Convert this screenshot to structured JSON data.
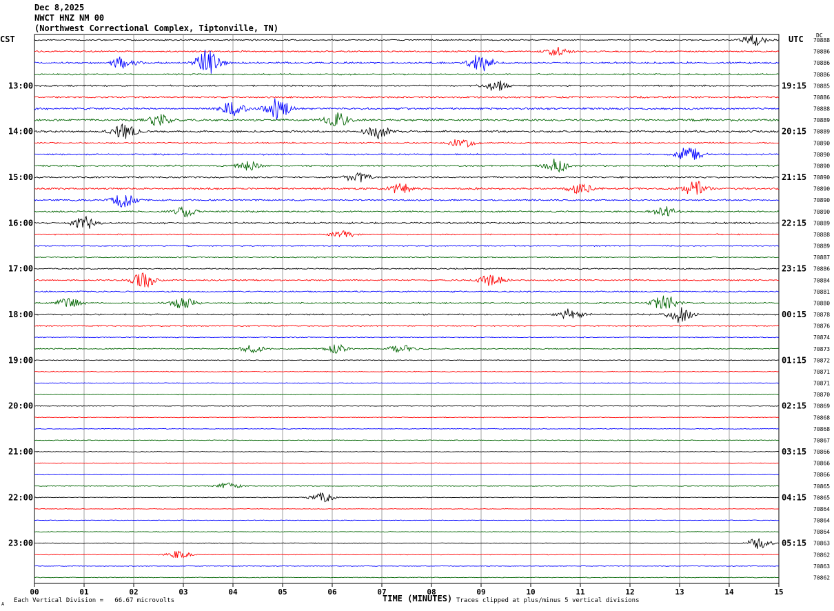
{
  "header": {
    "date": "Dec 8,2025",
    "station": "NWCT HNZ NM 00",
    "location": "(Northwest Correctional Complex, Tiptonville, TN)"
  },
  "left_tz": "CST",
  "right_tz": "UTC",
  "dc_label": "DC",
  "footer": {
    "scale": "Each Vertical Division =   66.67 microvolts",
    "clip": "Traces clipped at plus/minus 5 vertical divisions",
    "mark": "A"
  },
  "chart_data": {
    "type": "line",
    "title": "",
    "xlabel": "TIME (MINUTES)",
    "ylabel": "",
    "xlim": [
      0,
      15
    ],
    "x_ticks": [
      "00",
      "01",
      "02",
      "03",
      "04",
      "05",
      "06",
      "07",
      "08",
      "09",
      "10",
      "11",
      "12",
      "13",
      "14",
      "15"
    ],
    "grid": true,
    "trace_colors": [
      "#000000",
      "#ff0000",
      "#0000ff",
      "#006400"
    ],
    "left_hour_labels": [
      "13:00",
      "14:00",
      "15:00",
      "16:00",
      "17:00",
      "18:00",
      "19:00",
      "20:00",
      "21:00",
      "22:00",
      "23:00"
    ],
    "right_hour_labels": [
      "19:15",
      "20:15",
      "21:15",
      "22:15",
      "23:15",
      "00:15",
      "01:15",
      "02:15",
      "03:15",
      "04:15",
      "05:15"
    ],
    "dc_values": [
      "70888",
      "70886",
      "70886",
      "70886",
      "70885",
      "70886",
      "70888",
      "70889",
      "70889",
      "70890",
      "70890",
      "70890",
      "70890",
      "70890",
      "70890",
      "70890",
      "70889",
      "70888",
      "70889",
      "70887",
      "70886",
      "70884",
      "70881",
      "70880",
      "70878",
      "70876",
      "70874",
      "70873",
      "70872",
      "70871",
      "70871",
      "70870",
      "70869",
      "70868",
      "70868",
      "70867",
      "70866",
      "70866",
      "70866",
      "70865",
      "70865",
      "70864",
      "70864",
      "70864",
      "70863",
      "70862",
      "70863",
      "70862"
    ],
    "trace_activity": [
      0.5,
      0.55,
      0.7,
      0.55,
      0.55,
      0.65,
      0.7,
      0.75,
      0.75,
      0.55,
      0.55,
      0.6,
      0.6,
      0.7,
      0.6,
      0.6,
      0.65,
      0.45,
      0.45,
      0.4,
      0.45,
      0.55,
      0.5,
      0.55,
      0.55,
      0.45,
      0.35,
      0.4,
      0.3,
      0.3,
      0.3,
      0.28,
      0.28,
      0.28,
      0.28,
      0.3,
      0.28,
      0.25,
      0.25,
      0.28,
      0.28,
      0.25,
      0.25,
      0.25,
      0.28,
      0.28,
      0.25,
      0.28
    ],
    "events": [
      {
        "trace": 0,
        "minute": 14.5,
        "amp": 8
      },
      {
        "trace": 1,
        "minute": 10.5,
        "amp": 7
      },
      {
        "trace": 2,
        "minute": 3.5,
        "amp": 22
      },
      {
        "trace": 2,
        "minute": 9.0,
        "amp": 14
      },
      {
        "trace": 2,
        "minute": 1.8,
        "amp": 10
      },
      {
        "trace": 4,
        "minute": 9.3,
        "amp": 8
      },
      {
        "trace": 6,
        "minute": 4.9,
        "amp": 16
      },
      {
        "trace": 6,
        "minute": 4.0,
        "amp": 10
      },
      {
        "trace": 7,
        "minute": 6.1,
        "amp": 10
      },
      {
        "trace": 7,
        "minute": 2.5,
        "amp": 9
      },
      {
        "trace": 8,
        "minute": 1.8,
        "amp": 10
      },
      {
        "trace": 8,
        "minute": 6.9,
        "amp": 11
      },
      {
        "trace": 9,
        "minute": 8.6,
        "amp": 7
      },
      {
        "trace": 10,
        "minute": 13.2,
        "amp": 12
      },
      {
        "trace": 11,
        "minute": 10.5,
        "amp": 10
      },
      {
        "trace": 11,
        "minute": 4.3,
        "amp": 6
      },
      {
        "trace": 12,
        "minute": 6.5,
        "amp": 7
      },
      {
        "trace": 13,
        "minute": 7.4,
        "amp": 8
      },
      {
        "trace": 13,
        "minute": 13.3,
        "amp": 11
      },
      {
        "trace": 13,
        "minute": 11.0,
        "amp": 7
      },
      {
        "trace": 14,
        "minute": 1.8,
        "amp": 10
      },
      {
        "trace": 15,
        "minute": 3.0,
        "amp": 7
      },
      {
        "trace": 15,
        "minute": 12.7,
        "amp": 7
      },
      {
        "trace": 16,
        "minute": 1.0,
        "amp": 9
      },
      {
        "trace": 17,
        "minute": 6.2,
        "amp": 6
      },
      {
        "trace": 21,
        "minute": 2.2,
        "amp": 11
      },
      {
        "trace": 21,
        "minute": 9.2,
        "amp": 9
      },
      {
        "trace": 23,
        "minute": 12.7,
        "amp": 12
      },
      {
        "trace": 23,
        "minute": 3.0,
        "amp": 8
      },
      {
        "trace": 23,
        "minute": 0.7,
        "amp": 7
      },
      {
        "trace": 24,
        "minute": 13.0,
        "amp": 12
      },
      {
        "trace": 24,
        "minute": 10.8,
        "amp": 8
      },
      {
        "trace": 27,
        "minute": 4.4,
        "amp": 6
      },
      {
        "trace": 27,
        "minute": 7.4,
        "amp": 6
      },
      {
        "trace": 27,
        "minute": 6.1,
        "amp": 6
      },
      {
        "trace": 39,
        "minute": 3.9,
        "amp": 5
      },
      {
        "trace": 40,
        "minute": 5.8,
        "amp": 7
      },
      {
        "trace": 44,
        "minute": 14.6,
        "amp": 8
      },
      {
        "trace": 45,
        "minute": 2.9,
        "amp": 5
      }
    ]
  }
}
